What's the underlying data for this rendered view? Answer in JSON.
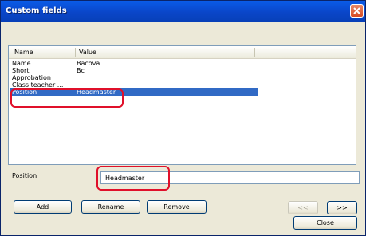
{
  "window": {
    "title": "Custom fields"
  },
  "list": {
    "columns": [
      "Name",
      "Value"
    ],
    "rows": [
      {
        "name": "Name",
        "value": "Bacova"
      },
      {
        "name": "Short",
        "value": "Bc"
      },
      {
        "name": "Approbation",
        "value": ""
      },
      {
        "name": "Class teacher ...",
        "value": ""
      },
      {
        "name": "Position",
        "value": "Headmaster",
        "selected": true
      }
    ]
  },
  "editor": {
    "label": "Position",
    "value": "Headmaster"
  },
  "buttons": {
    "add": "Add",
    "rename": "Rename",
    "remove": "Remove",
    "prev": "<<",
    "next": ">>",
    "close": "Close"
  },
  "colors": {
    "selection": "#316ac5",
    "annotation": "#e0102a"
  }
}
